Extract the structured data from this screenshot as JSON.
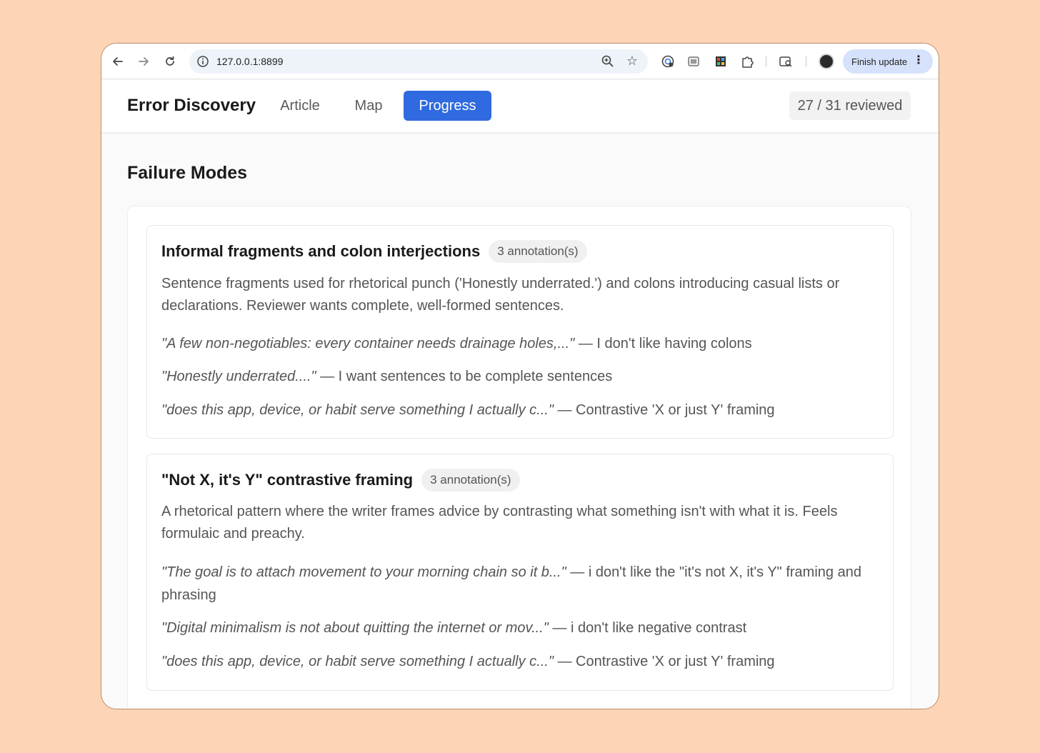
{
  "browser": {
    "url": "127.0.0.1:8899",
    "finish_label": "Finish update"
  },
  "app": {
    "brand": "Error Discovery",
    "nav": [
      {
        "label": "Article",
        "active": false
      },
      {
        "label": "Map",
        "active": false
      },
      {
        "label": "Progress",
        "active": true
      }
    ],
    "reviewed": "27 / 31 reviewed",
    "accent": "#2f6ae0"
  },
  "main": {
    "title": "Failure Modes",
    "cards": [
      {
        "title": "Informal fragments and colon interjections",
        "badge": "3 annotation(s)",
        "description": "Sentence fragments used for rhetorical punch ('Honestly underrated.') and colons introducing casual lists or declarations. Reviewer wants complete, well-formed sentences.",
        "examples": [
          {
            "quote": "\"A few non-negotiables: every container needs drainage holes,...\"",
            "note": " — I don't like having colons"
          },
          {
            "quote": "\"Honestly underrated....\"",
            "note": " — I want sentences to be complete sentences"
          },
          {
            "quote": "\"does this app, device, or habit serve something I actually c...\"",
            "note": " — Contrastive 'X or just Y' framing"
          }
        ]
      },
      {
        "title": "\"Not X, it's Y\" contrastive framing",
        "badge": "3 annotation(s)",
        "description": "A rhetorical pattern where the writer frames advice by contrasting what something isn't with what it is. Feels formulaic and preachy.",
        "examples": [
          {
            "quote": "\"The goal is to attach movement to your morning chain so it b...\"",
            "note": " — i don't like the \"it's not X, it's Y\" framing and phrasing"
          },
          {
            "quote": "\"Digital minimalism is not about quitting the internet or mov...\"",
            "note": " — i don't like negative contrast"
          },
          {
            "quote": "\"does this app, device, or habit serve something I actually c...\"",
            "note": " — Contrastive 'X or just Y' framing"
          }
        ]
      }
    ]
  }
}
